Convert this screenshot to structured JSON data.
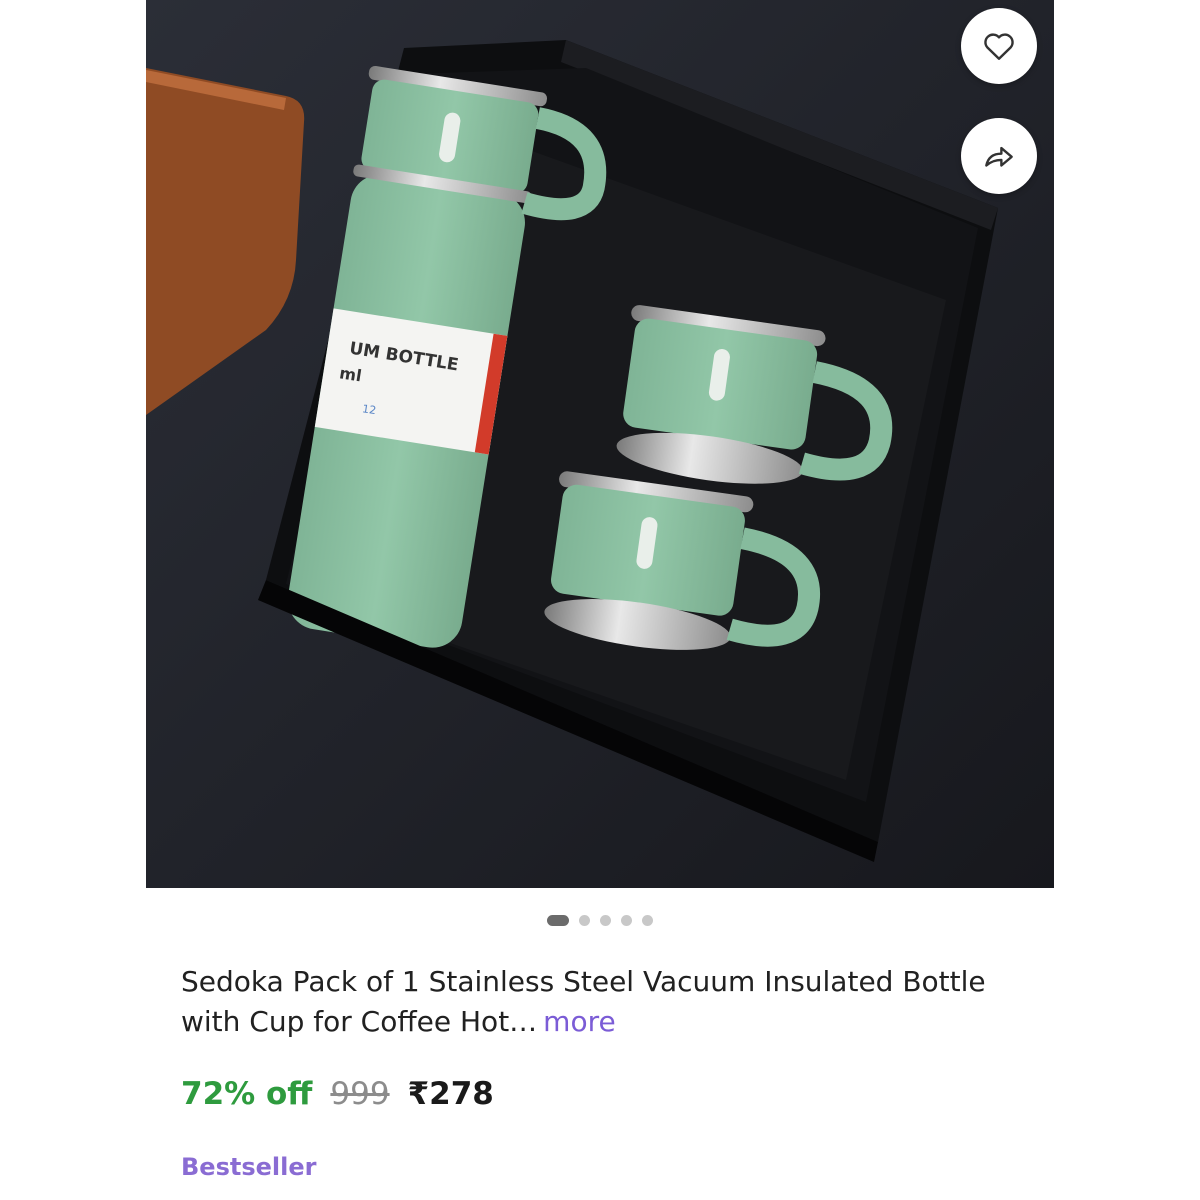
{
  "product": {
    "image_alt": "Green vacuum bottle with three cups in black gift box",
    "bottle_label_line1": "UM BOTTLE",
    "bottle_label_line2": "ml",
    "bottle_label_small": "12",
    "title_text": "Sedoka Pack of 1 Stainless Steel Vacuum Insulated Bottle with Cup for Coffee Hot…",
    "more_label": "more",
    "discount": "72% off",
    "mrp": "999",
    "price": "₹278",
    "badge": "Bestseller"
  },
  "carousel": {
    "total_slides": 5,
    "active_index": 0
  },
  "actions": {
    "wishlist_icon": "heart-icon",
    "share_icon": "share-arrow-icon"
  },
  "colors": {
    "discount": "#2e9b3e",
    "link": "#7b5cd6",
    "badge": "#8a6cd3",
    "product_green": "#8cc1a3"
  }
}
